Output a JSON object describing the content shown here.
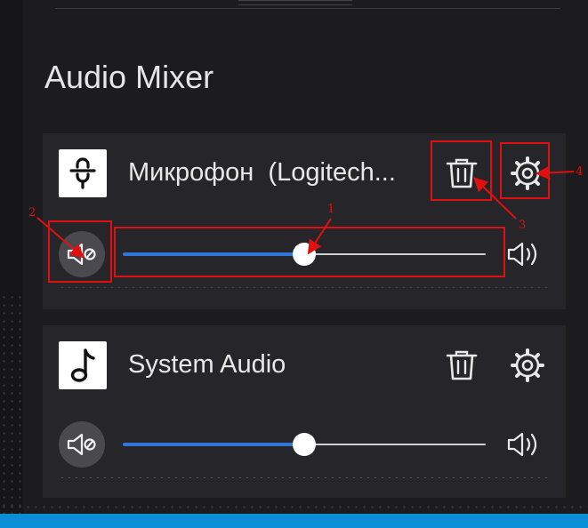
{
  "panel": {
    "title": "Audio Mixer"
  },
  "sources": [
    {
      "name": "Микрофон  (Logitech...",
      "icon": "microphone-icon",
      "volume_fraction": 0.5,
      "muted": false
    },
    {
      "name": "System Audio",
      "icon": "music-note-icon",
      "volume_fraction": 0.5,
      "muted": false
    }
  ],
  "annotations": {
    "labels": [
      "1",
      "2",
      "3",
      "4"
    ],
    "color": "#e01010"
  },
  "colors": {
    "accent": "#2f76d6",
    "card": "#26262a",
    "background": "#161618",
    "taskbar": "#0a8fd6"
  }
}
